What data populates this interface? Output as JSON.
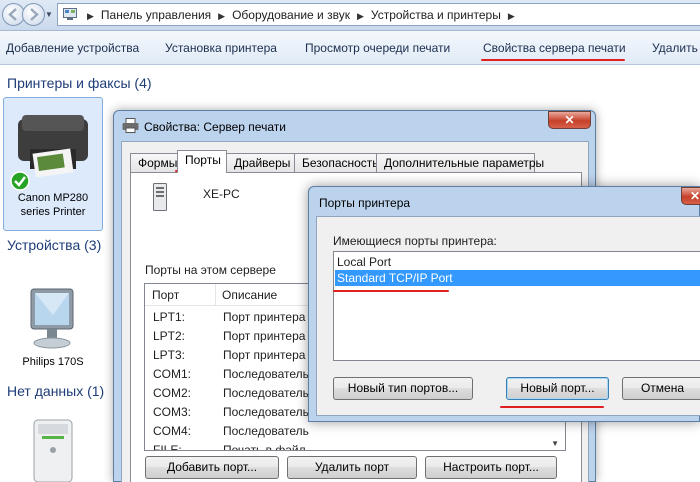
{
  "address_bar": {
    "crumbs": [
      "Панель управления",
      "Оборудование и звук",
      "Устройства и принтеры"
    ]
  },
  "toolbar": {
    "items": [
      "Добавление устройства",
      "Установка принтера",
      "Просмотр очереди печати",
      "Свойства сервера печати",
      "Удалить у"
    ]
  },
  "explorer": {
    "groups": [
      "Принтеры и факсы (4)",
      "Устройства (3)",
      "Нет данных (1)"
    ],
    "printer": {
      "line1": "Canon MP280",
      "line2": "series Printer"
    },
    "monitor": {
      "label": "Philips 170S"
    }
  },
  "server_dialog": {
    "title": "Свойства: Сервер печати",
    "close": "✕",
    "tabs": [
      "Формы",
      "Порты",
      "Драйверы",
      "Безопасность",
      "Дополнительные параметры"
    ],
    "server_name": "XE-PC",
    "ports_label": "Порты на этом сервере",
    "columns": [
      "Порт",
      "Описание"
    ],
    "ports": [
      {
        "port": "LPT1:",
        "desc": "Порт принтера"
      },
      {
        "port": "LPT2:",
        "desc": "Порт принтера"
      },
      {
        "port": "LPT3:",
        "desc": "Порт принтера"
      },
      {
        "port": "COM1:",
        "desc": "Последователь"
      },
      {
        "port": "COM2:",
        "desc": "Последователь"
      },
      {
        "port": "COM3:",
        "desc": "Последователь"
      },
      {
        "port": "COM4:",
        "desc": "Последователь"
      },
      {
        "port": "FILE:",
        "desc": "Печать в файл"
      }
    ],
    "buttons": {
      "add": "Добавить порт...",
      "remove": "Удалить порт",
      "configure": "Настроить порт..."
    }
  },
  "ports_dialog": {
    "title": "Порты принтера",
    "close": "✕",
    "available_label": "Имеющиеся порты принтера:",
    "ports": [
      "Local Port",
      "Standard TCP/IP Port"
    ],
    "buttons": {
      "new_type": "Новый тип портов...",
      "new_port": "Новый порт...",
      "cancel": "Отмена"
    }
  },
  "accent": {
    "highlight": "#e0201e",
    "selection": "#3399ff"
  }
}
